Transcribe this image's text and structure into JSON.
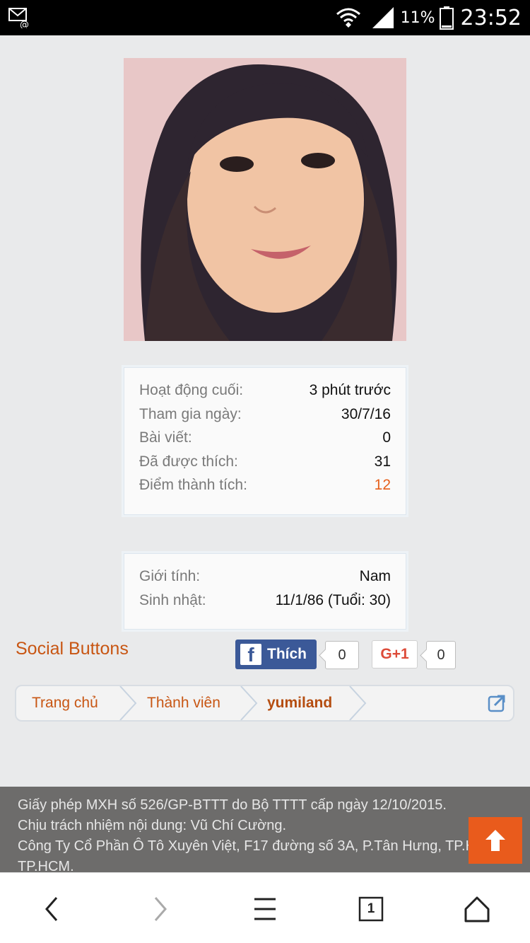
{
  "status_bar": {
    "battery_text": "11%",
    "time": "23:52"
  },
  "profile": {
    "stats": [
      {
        "label": "Hoạt động cuối:",
        "value": "3 phút trước"
      },
      {
        "label": "Tham gia ngày:",
        "value": "30/7/16"
      },
      {
        "label": "Bài viết:",
        "value": "0"
      },
      {
        "label": "Đã được thích:",
        "value": "31"
      },
      {
        "label": "Điểm thành tích:",
        "value": "12"
      }
    ],
    "details": [
      {
        "label": "Giới tính:",
        "value": "Nam"
      },
      {
        "label": "Sinh nhật:",
        "value": "11/1/86 (Tuổi: 30)"
      }
    ]
  },
  "social": {
    "title": "Social Buttons",
    "facebook_label": "Thích",
    "facebook_count": "0",
    "gplus_label": "G+1",
    "gplus_count": "0"
  },
  "breadcrumb": {
    "items": [
      "Trang chủ",
      "Thành viên",
      "yumiland"
    ]
  },
  "footer": {
    "lines": [
      "Giấy phép MXH số 526/GP-BTTT do Bộ TTTT cấp ngày 12/10/2015.",
      "Chịu trách nhiệm nội dung: Vũ Chí Cường.",
      "Công Ty Cổ Phần Ô Tô Xuyên Việt, F17 đường số 3A, P.Tân Hưng, TP.HCM.",
      "TP.HCM."
    ]
  },
  "browser_nav": {
    "tab_count": "1"
  },
  "colors": {
    "accent": "#c85613",
    "highlight": "#e6601c",
    "facebook": "#3b5998",
    "scroll_top": "#e95b1c",
    "footer_bg": "#6d6c6b"
  }
}
